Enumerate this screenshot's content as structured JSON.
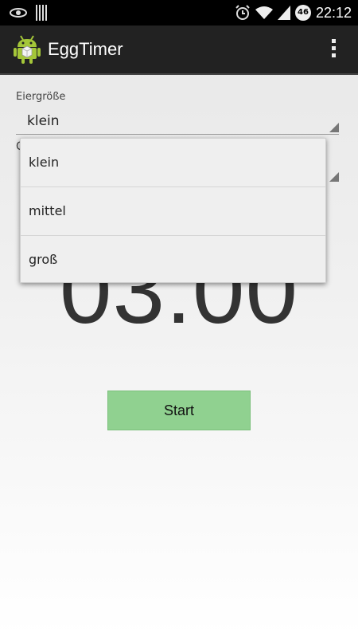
{
  "status_bar": {
    "time": "22:12",
    "network_badge": "46",
    "icons": [
      "eye-icon",
      "sd-card-icon",
      "alarm-icon",
      "wifi-icon",
      "signal-icon"
    ]
  },
  "action_bar": {
    "title": "EggTimer",
    "app_icon": "android-egg-icon",
    "menu_icon": "overflow-menu-icon"
  },
  "form": {
    "egg_size_label": "Eiergröße",
    "egg_size_value": "klein",
    "second_field_label_partial": "C"
  },
  "dropdown": {
    "options": [
      "klein",
      "mittel",
      "groß"
    ]
  },
  "timer": {
    "display": "03:00"
  },
  "actions": {
    "start_label": "Start"
  },
  "colors": {
    "start_button": "#90d190",
    "action_bar": "#222222",
    "android_green": "#a4c639"
  }
}
